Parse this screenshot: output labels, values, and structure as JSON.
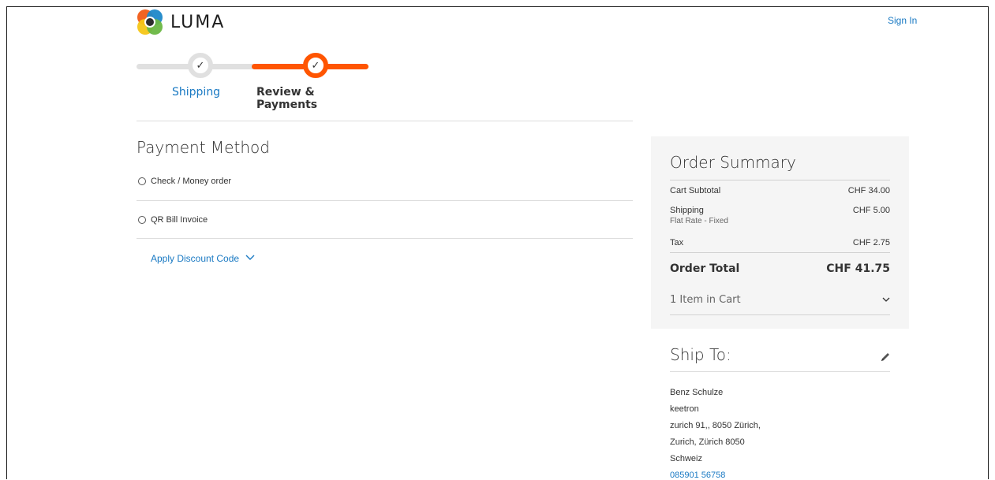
{
  "header": {
    "brand": "LUMA",
    "sign_in": "Sign In"
  },
  "progress": {
    "steps": [
      {
        "label": "Shipping",
        "state": "complete"
      },
      {
        "label": "Review & Payments",
        "state": "active"
      }
    ],
    "check_glyph": "✓"
  },
  "payment": {
    "title": "Payment Method",
    "options": [
      {
        "label": "Check / Money order",
        "selected": false
      },
      {
        "label": "QR Bill Invoice",
        "selected": false
      }
    ],
    "discount_label": "Apply Discount Code"
  },
  "summary": {
    "title": "Order Summary",
    "rows": [
      {
        "label": "Cart Subtotal",
        "value": "CHF 34.00"
      },
      {
        "label": "Shipping",
        "sublabel": "Flat Rate - Fixed",
        "value": "CHF 5.00"
      },
      {
        "label": "Tax",
        "value": "CHF 2.75"
      }
    ],
    "total_label": "Order Total",
    "total_value": "CHF 41.75",
    "items_in_cart": "1 Item in Cart"
  },
  "ship_to": {
    "title": "Ship To:",
    "address_lines": [
      "Benz Schulze",
      "keetron",
      "zurich 91,, 8050 Zürich,",
      "Zurich, Zürich 8050",
      "Schweiz"
    ],
    "phone": "085901 56758"
  },
  "colors": {
    "accent_orange": "#ff5501",
    "link_blue": "#1979c3",
    "summary_bg": "#f5f5f5"
  },
  "icons": {
    "logo": "luma-logo-icon",
    "edit": "pencil-icon",
    "chevron": "chevron-down-icon"
  }
}
